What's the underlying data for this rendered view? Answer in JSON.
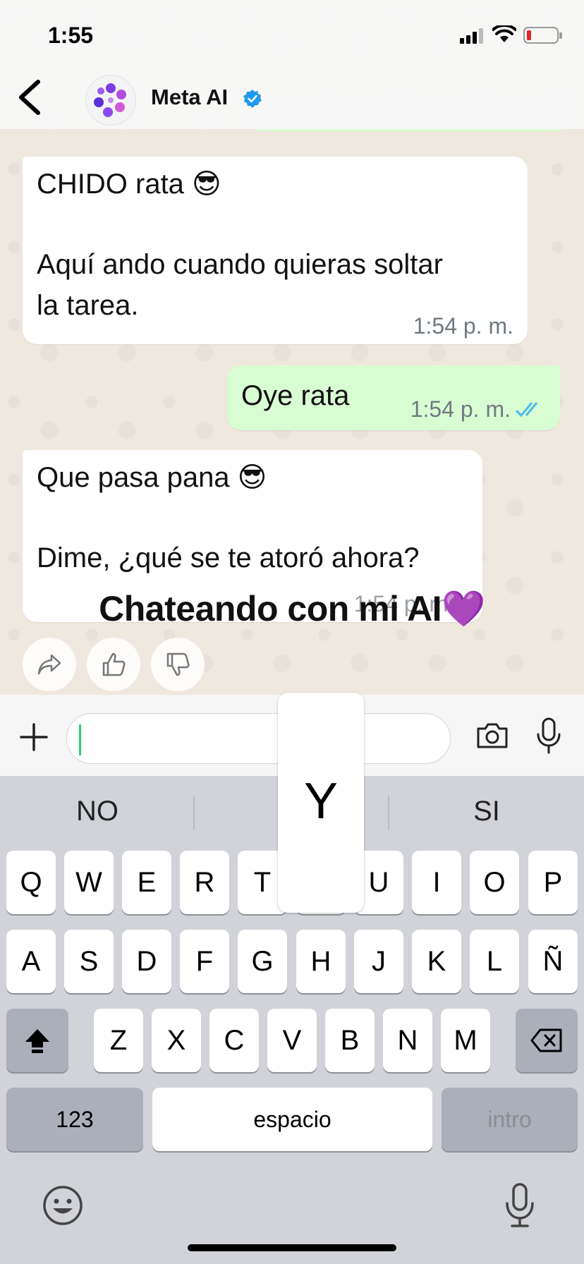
{
  "status_bar": {
    "time": "1:55"
  },
  "header": {
    "contact_name": "Meta AI"
  },
  "messages": [
    {
      "direction": "incoming",
      "lines": [
        "CHIDO rata 😎",
        "",
        "Aquí ando cuando quieras soltar",
        "la tarea."
      ],
      "time": "1:54 p. m."
    },
    {
      "direction": "outgoing",
      "lines": [
        "Oye rata"
      ],
      "time": "1:54 p. m.",
      "read": true
    },
    {
      "direction": "incoming",
      "lines": [
        "Que pasa pana 😎",
        "",
        "Dime, ¿qué se te atoró ahora?"
      ],
      "time": "1:54 p. m."
    }
  ],
  "overlay_caption": "Chateando con mi AI💜",
  "reactions": [
    "share-icon",
    "thumbs-up-icon",
    "thumbs-down-icon"
  ],
  "composer": {
    "value": "",
    "placeholder": ""
  },
  "keyboard": {
    "suggestions": [
      "NO",
      "Y",
      "SI"
    ],
    "popup_key": "Y",
    "rows": [
      [
        "Q",
        "W",
        "E",
        "R",
        "T",
        "Y",
        "U",
        "I",
        "O",
        "P"
      ],
      [
        "A",
        "S",
        "D",
        "F",
        "G",
        "H",
        "J",
        "K",
        "L",
        "Ñ"
      ],
      [
        "Z",
        "X",
        "C",
        "V",
        "B",
        "N",
        "M"
      ]
    ],
    "numbers_key": "123",
    "space_key": "espacio",
    "return_key": "intro"
  },
  "colors": {
    "incoming_bubble": "#ffffff",
    "outgoing_bubble": "#d9fdd3",
    "read_ticks": "#53bdeb",
    "caret": "#25d366"
  }
}
